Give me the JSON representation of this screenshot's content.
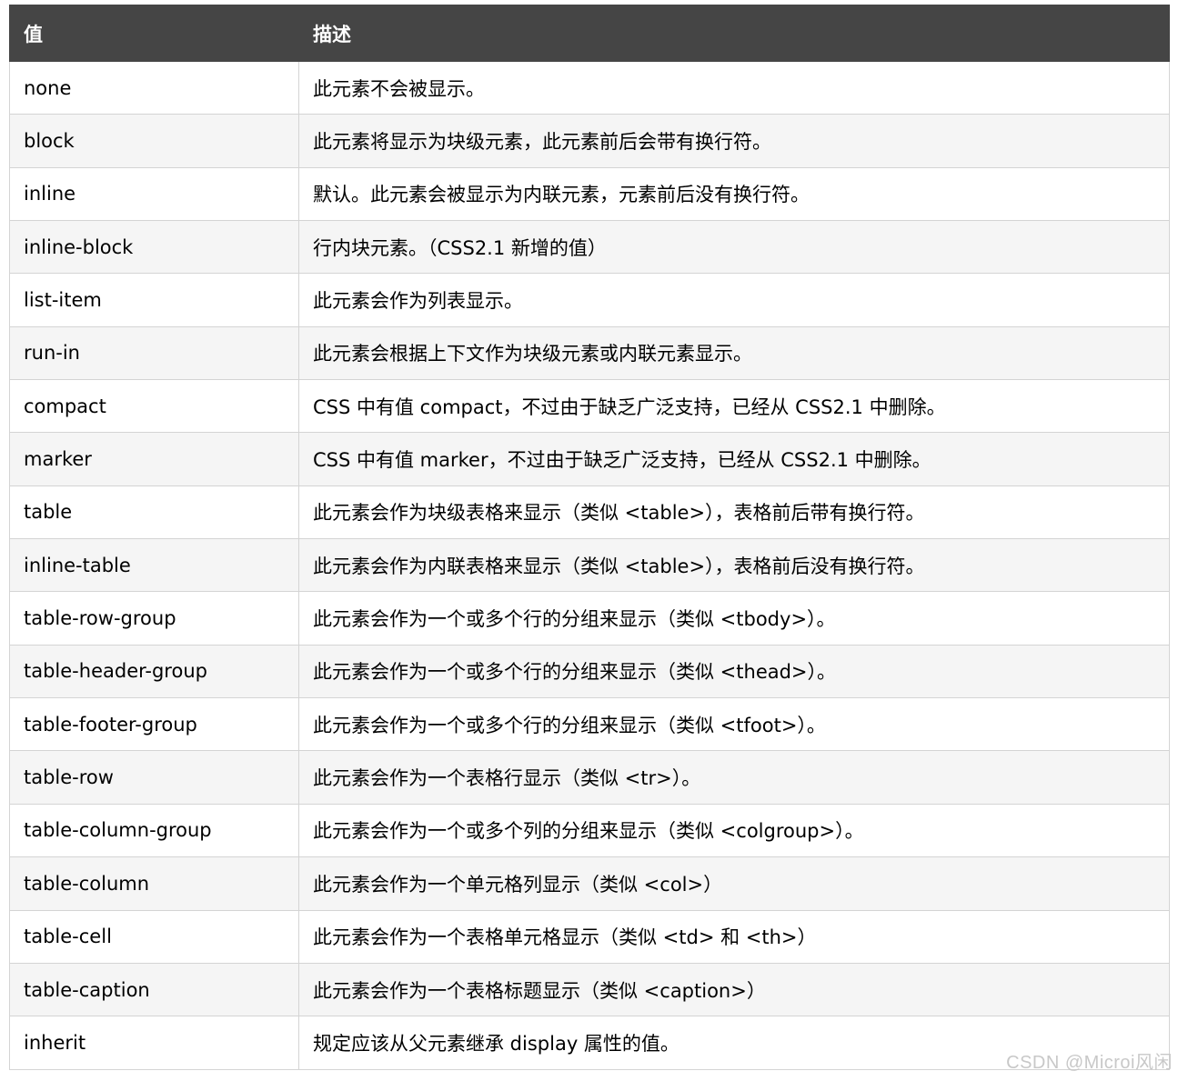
{
  "table": {
    "headers": [
      "值",
      "描述"
    ],
    "rows": [
      {
        "value": "none",
        "description": "此元素不会被显示。"
      },
      {
        "value": "block",
        "description": "此元素将显示为块级元素，此元素前后会带有换行符。"
      },
      {
        "value": "inline",
        "description": "默认。此元素会被显示为内联元素，元素前后没有换行符。"
      },
      {
        "value": "inline-block",
        "description": "行内块元素。（CSS2.1 新增的值）"
      },
      {
        "value": "list-item",
        "description": "此元素会作为列表显示。"
      },
      {
        "value": "run-in",
        "description": "此元素会根据上下文作为块级元素或内联元素显示。"
      },
      {
        "value": "compact",
        "description": "CSS 中有值 compact，不过由于缺乏广泛支持，已经从 CSS2.1 中删除。"
      },
      {
        "value": "marker",
        "description": "CSS 中有值 marker，不过由于缺乏广泛支持，已经从 CSS2.1 中删除。"
      },
      {
        "value": "table",
        "description": "此元素会作为块级表格来显示（类似 <table>），表格前后带有换行符。"
      },
      {
        "value": "inline-table",
        "description": "此元素会作为内联表格来显示（类似 <table>），表格前后没有换行符。"
      },
      {
        "value": "table-row-group",
        "description": "此元素会作为一个或多个行的分组来显示（类似 <tbody>）。"
      },
      {
        "value": "table-header-group",
        "description": "此元素会作为一个或多个行的分组来显示（类似 <thead>）。"
      },
      {
        "value": "table-footer-group",
        "description": "此元素会作为一个或多个行的分组来显示（类似 <tfoot>）。"
      },
      {
        "value": "table-row",
        "description": "此元素会作为一个表格行显示（类似 <tr>）。"
      },
      {
        "value": "table-column-group",
        "description": "此元素会作为一个或多个列的分组来显示（类似 <colgroup>）。"
      },
      {
        "value": "table-column",
        "description": "此元素会作为一个单元格列显示（类似 <col>）"
      },
      {
        "value": "table-cell",
        "description": "此元素会作为一个表格单元格显示（类似 <td> 和 <th>）"
      },
      {
        "value": "table-caption",
        "description": "此元素会作为一个表格标题显示（类似 <caption>）"
      },
      {
        "value": "inherit",
        "description": "规定应该从父元素继承 display 属性的值。"
      }
    ]
  },
  "watermark": "CSDN @Microi风闲",
  "colors": {
    "header_bg": "#454545",
    "header_text": "#ffffff",
    "row_alt_bg": "#f5f5f5",
    "border": "#d4d4d4"
  }
}
